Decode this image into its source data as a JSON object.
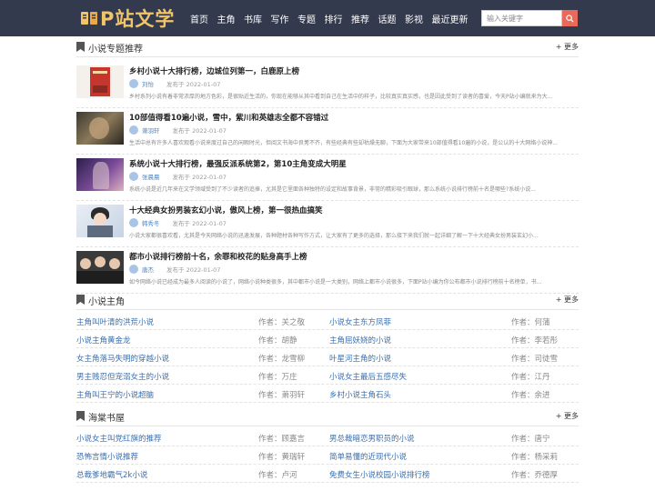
{
  "header": {
    "logo_text": "P站文学",
    "logo_icon": "book-icon",
    "nav": [
      "首页",
      "主角",
      "书库",
      "写作",
      "专题",
      "排行",
      "推荐",
      "话题",
      "影视",
      "最近更新"
    ],
    "search_placeholder": "输入关键字",
    "search_icon": "search-icon"
  },
  "topics": {
    "title": "小说专题推荐",
    "more": "+ 更多",
    "articles": [
      {
        "title": "乡村小说十大排行榜，边城位列第一，白鹿原上榜",
        "author": "刘怡",
        "date": "发布于 2022-01-07",
        "desc": "乡村系列小说有着非常浓厚的地方色彩，是很贴近生活的，你现在能够从其中看到自己在生活中的样子，比较真实真实感，也是因此受到了读者的喜爱，今天P站小编就来为大..."
      },
      {
        "title": "10部值得看10遍小说，雪中，紫川和英雄志全都不容错过",
        "author": "萧羽轩",
        "date": "发布于 2022-01-07",
        "desc": "生活中总有许多人喜欢观看小说来度过自己的闲暇时光，但阅文书海中良莠不齐，有些经典有些却枯燥无聊，下面为大家带来10部值得看10遍的小说，是公认的十大网络小说神..."
      },
      {
        "title": "系统小说十大排行榜，最强反派系统第2，第10主角变成大明星",
        "author": "张晨晨",
        "date": "发布于 2022-01-07",
        "desc": "系统小说是近几年来在文学领域受到了不少读者的追捧，尤其是它里面各种独特的设定和故事背景，非常的精彩吸引眼球，那么系统小说排行榜前十名是哪些?系统小说..."
      },
      {
        "title": "十大经典女扮男装玄幻小说，傲风上榜，第一很热血搞笑",
        "author": "韩秀冬",
        "date": "发布于 2022-01-07",
        "desc": "小说大家都很喜欢看，尤其是今天网络小说的迅速发展，各种题材各种写作方式，让大家有了更多的选择，那么接下来我们就一起详细了解一下十大经典女扮男装玄幻小..."
      },
      {
        "title": "都市小说排行榜前十名，余罪和校花的贴身高手上榜",
        "author": "唐杰",
        "date": "发布于 2022-01-07",
        "desc": "如今网络小说已经成为最多人阅读的小说了，网络小说种类很多，其中都市小说是一大类别，网络上都市小说很多，下面P站小编为你公布都市小说排行榜前十名榜单，书..."
      }
    ]
  },
  "protagonists": {
    "title": "小说主角",
    "more": "+ 更多",
    "rows": [
      {
        "t1": "主角叫叶清的洪荒小说",
        "a1": "作者：关之敬",
        "t2": "小说女主东方凤菲",
        "a2": "作者：何蒲"
      },
      {
        "t1": "小说主角黄金龙",
        "a1": "作者：胡静",
        "t2": "主角屈妖娆的小说",
        "a2": "作者：李若彤"
      },
      {
        "t1": "女主角落马失明的穿越小说",
        "a1": "作者：龙雪柳",
        "t2": "叶星河主角的小说",
        "a2": "作者：司徒雪"
      },
      {
        "t1": "男主贱忍但宠溺女主的小说",
        "a1": "作者：万庄",
        "t2": "小说女主最后五感尽失",
        "a2": "作者：江丹"
      },
      {
        "t1": "主角叫王宁的小说超脑",
        "a1": "作者：萧羽轩",
        "t2": "乡村小说主角石头",
        "a2": "作者：余进"
      }
    ]
  },
  "haitang": {
    "title": "海棠书屋",
    "more": "+ 更多",
    "rows": [
      {
        "t1": "小说女主叫党红旗的推荐",
        "a1": "作者：顾嘉言",
        "t2": "男总裁暗恋男职员的小说",
        "a2": "作者：唐宁"
      },
      {
        "t1": "恐怖言情小说推荐",
        "a1": "作者：黄瑞轩",
        "t2": "简单易懂的近现代小说",
        "a2": "作者：杨采莉"
      },
      {
        "t1": "总裁爹地霸气2k小说",
        "a1": "作者：卢河",
        "t2": "免费女生小说校园小说排行榜",
        "a2": "作者：乔德厚"
      }
    ]
  },
  "colors": {
    "header_bg": "#333a4d",
    "logo": "#f0c468",
    "link": "#3b6fae",
    "search_btn": "#e86a5a"
  }
}
